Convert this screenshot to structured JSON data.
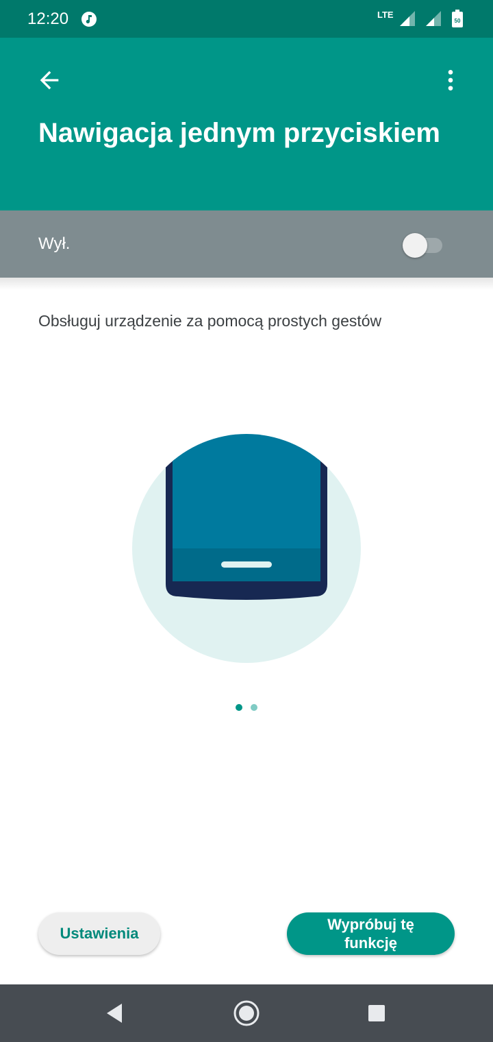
{
  "status_bar": {
    "time": "12:20",
    "network": "LTE",
    "battery": "50",
    "icons": [
      "music-icon",
      "signal-icon",
      "signal-icon",
      "battery-icon"
    ]
  },
  "app_bar": {
    "title": "Nawigacja jednym przyciskiem",
    "back_icon": "arrow-back-icon",
    "menu_icon": "more-vert-icon"
  },
  "master_switch": {
    "label": "Wył.",
    "checked": false
  },
  "description": "Obsługuj urządzenie za pomocą prostych gestów",
  "pager": {
    "pages": 2,
    "current": 1
  },
  "buttons": {
    "settings": "Ustawienia",
    "try": "Wypróbuj tę funkcję"
  },
  "nav_bar": {
    "back": "nav-back-icon",
    "home": "nav-home-icon",
    "recents": "nav-recents-icon"
  },
  "colors": {
    "status_bar": "#00796b",
    "app_bar": "#009688",
    "switch_bar_off": "#7f8c90",
    "accent": "#009688",
    "illustration_circle": "#e0f2f1",
    "illustration_screen": "#007a9e",
    "illustration_frame": "#172852",
    "nav_bar": "#474c52"
  }
}
